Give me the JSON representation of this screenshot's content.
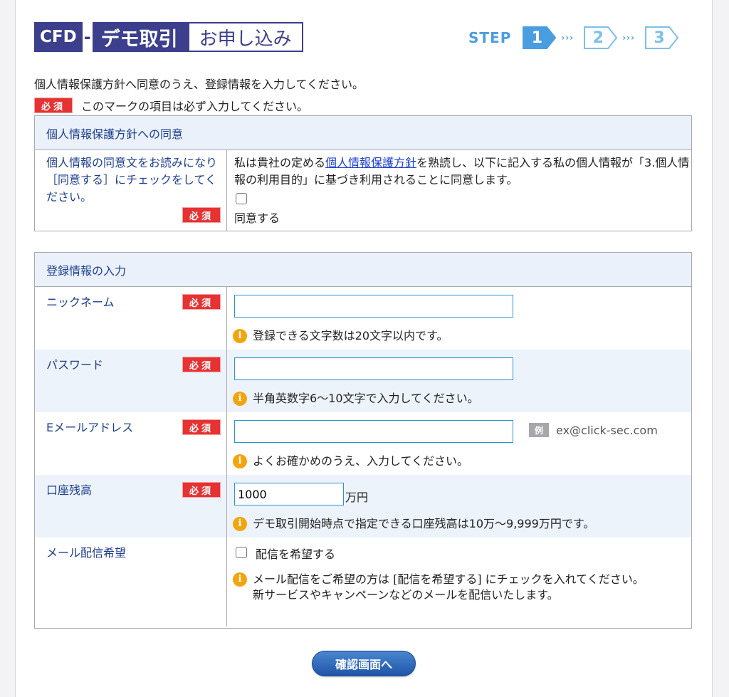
{
  "header": {
    "logo_cfd": "CFD",
    "logo_dash": "-",
    "logo_demo": "デモ取引",
    "logo_apply": "お申し込み",
    "step_label": "STEP",
    "steps": [
      "1",
      "2",
      "3"
    ],
    "step_dots": "›››",
    "active_step": 1
  },
  "intro_text": "個人情報保護方針へ同意のうえ、登録情報を入力してください。",
  "required_badge": "必須",
  "required_note": "このマークの項目は必ず入力してください。",
  "consent_section": {
    "title": "個人情報保護方針への同意",
    "label": "個人情報の同意文をお読みになり［同意する］にチェックをしてください。",
    "text_before": "私は貴社の定める",
    "link_text": "個人情報保護方針",
    "text_after": "を熟読し、以下に記入する私の個人情報が「3.個人情報の利用目的」に基づき利用されることに同意します。",
    "checkbox_label": "同意する"
  },
  "registration_section": {
    "title": "登録情報の入力",
    "nickname": {
      "label": "ニックネーム",
      "value": "",
      "hint": "登録できる文字数は20文字以内です。"
    },
    "password": {
      "label": "パスワード",
      "value": "",
      "hint": "半角英数字6〜10文字で入力してください。"
    },
    "email": {
      "label": "Eメールアドレス",
      "value": "",
      "example_badge": "例",
      "example": "ex@click-sec.com",
      "hint": "よくお確かめのうえ、入力してください。"
    },
    "balance": {
      "label": "口座残高",
      "value": "1000",
      "unit": "万円",
      "hint": "デモ取引開始時点で指定できる口座残高は10万〜9,999万円です。"
    },
    "mail_delivery": {
      "label": "メール配信希望",
      "checkbox_label": "配信を希望する",
      "hint_line1": "メール配信をご希望の方は [配信を希望する] にチェックを入れてください。",
      "hint_line2": "新サービスやキャンペーンなどのメールを配信いたします。"
    }
  },
  "confirm_button": "確認画面へ",
  "info_icon_glyph": "i",
  "colors": {
    "brand": "#3c3f8c",
    "step_blue": "#4a9ee0",
    "required_red": "#e63232",
    "section_head_bg": "#eaf1fb",
    "label_text": "#1c3e8e",
    "info_orange": "#f2a50f",
    "button_blue": "#1f55a8"
  }
}
